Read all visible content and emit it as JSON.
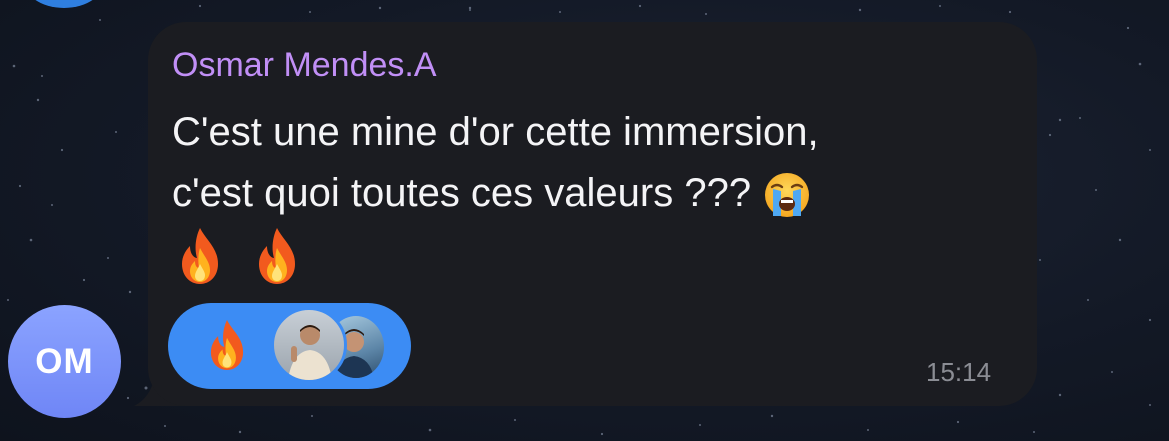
{
  "chat": {
    "incoming_message": {
      "sender_name": "Osmar Mendes.A",
      "avatar_initials": "OM",
      "lines": [
        "C'est une mine d'or cette immersion,",
        "c'est quoi toutes ces valeurs ???"
      ],
      "inline_emoji": "loudly-crying-face",
      "trailing_emojis": [
        "fire",
        "fire"
      ],
      "time": "15:14",
      "reactions": [
        {
          "emoji": "fire",
          "reactor_count": 2
        }
      ]
    }
  },
  "colors": {
    "sender_name": "#c18ff6",
    "bubble": "#1b1c21",
    "avatar": "#7b93fb",
    "reaction_pill": "#3c8cf4",
    "message_text": "#f4f4f6",
    "time_text": "#8b8d94",
    "background": "#141a26"
  }
}
